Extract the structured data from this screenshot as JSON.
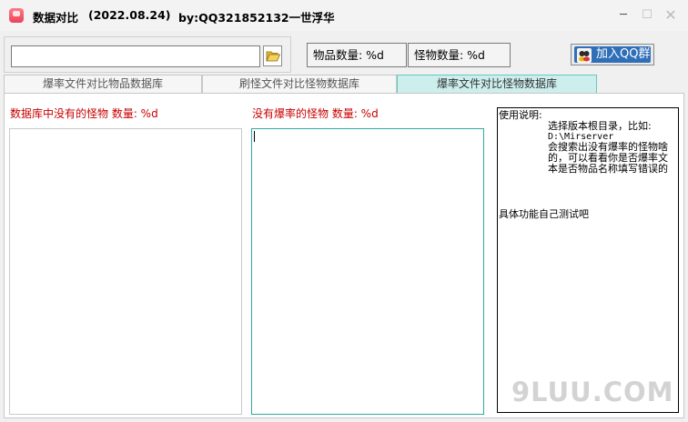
{
  "window": {
    "title": "数据对比",
    "date": "(2022.08.24)",
    "author": "by:QQ321852132一世浮华",
    "minimize_glyph": "─",
    "maximize_glyph": "☐",
    "close_glyph": "✕"
  },
  "toolbar": {
    "path_value": "",
    "folder_icon": "folder-open-icon",
    "item_count_label": "物品数量: %d",
    "monster_count_label": "怪物数量: %d",
    "qq_group_button": "加入QQ群",
    "qq_icon": "qq-group-icon"
  },
  "tabs": [
    {
      "label": "爆率文件对比物品数据库",
      "active": false
    },
    {
      "label": "刷怪文件对比怪物数据库",
      "active": false
    },
    {
      "label": "爆率文件对比怪物数据库",
      "active": true
    }
  ],
  "panel": {
    "left_label": "数据库中没有的怪物  数量: %d",
    "middle_label": "没有爆率的怪物  数量: %d",
    "left_list": [],
    "middle_list": [],
    "info": {
      "line1": "使用说明:",
      "line2": "选择版本根目录，比如:",
      "line3": "D:\\Mirserver",
      "line4": "会搜索出没有爆率的怪物啥",
      "line5": "的，可以看看你是否爆率文",
      "line6": "本是否物品名称填写错误的",
      "line7": "具体功能自己测试吧"
    }
  },
  "watermark": "9LUU.COM",
  "colors": {
    "accent_red": "#c80000",
    "active_tab": "#cceeed",
    "active_border": "#2eaaa0",
    "qq_button": "#2f6fb8"
  }
}
